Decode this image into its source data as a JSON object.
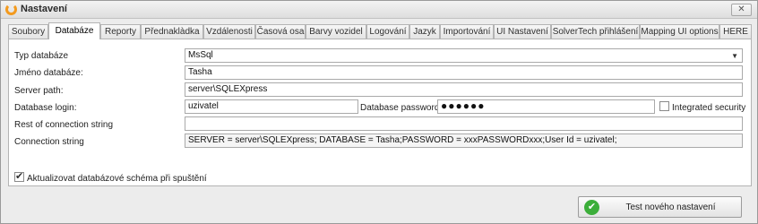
{
  "window": {
    "title": "Nastavení",
    "close_glyph": "✕",
    "icon": "app-logo-icon"
  },
  "tabs": [
    {
      "label": "Soubory",
      "active": false
    },
    {
      "label": "Databáze",
      "active": true
    },
    {
      "label": "Reporty",
      "active": false
    },
    {
      "label": "Přednaklàdka",
      "active": false
    },
    {
      "label": "Vzdálenosti",
      "active": false
    },
    {
      "label": "Časová osa",
      "active": false
    },
    {
      "label": "Barvy vozidel",
      "active": false
    },
    {
      "label": "Logování",
      "active": false
    },
    {
      "label": "Jazyk",
      "active": false
    },
    {
      "label": "Importování",
      "active": false
    },
    {
      "label": "UI Nastavení",
      "active": false
    },
    {
      "label": "SolverTech přihlášení",
      "active": false
    },
    {
      "label": "Mapping UI options",
      "active": false
    },
    {
      "label": "HERE",
      "active": false
    }
  ],
  "form": {
    "db_type": {
      "label": "Typ databáze",
      "value": "MsSql"
    },
    "db_name": {
      "label": "Jméno databáze:",
      "value": "Tasha"
    },
    "server_path": {
      "label": "Server path:",
      "value": "server\\SQLEXpress"
    },
    "db_login": {
      "label": "Database login:",
      "value": "uzivatel"
    },
    "db_password": {
      "label": "Database password:",
      "value": "●●●●●●"
    },
    "integrated_security": {
      "label": "Integrated security",
      "checked": false
    },
    "rest_connection": {
      "label": "Rest of connection string",
      "value": ""
    },
    "connection_string": {
      "label": "Connection string",
      "value": "SERVER = server\\SQLEXpress; DATABASE = Tasha;PASSWORD = xxxPASSWORDxxx;User Id = uzivatel;"
    },
    "update_schema": {
      "label": "Aktualizovat databázové schéma při spuštění",
      "checked": true
    }
  },
  "actions": {
    "test_button": "Test nového nastavení",
    "test_icon": "checkmark-icon"
  },
  "colors": {
    "accent_orange": "#f39a1e",
    "ok_green": "#3cae3a"
  }
}
